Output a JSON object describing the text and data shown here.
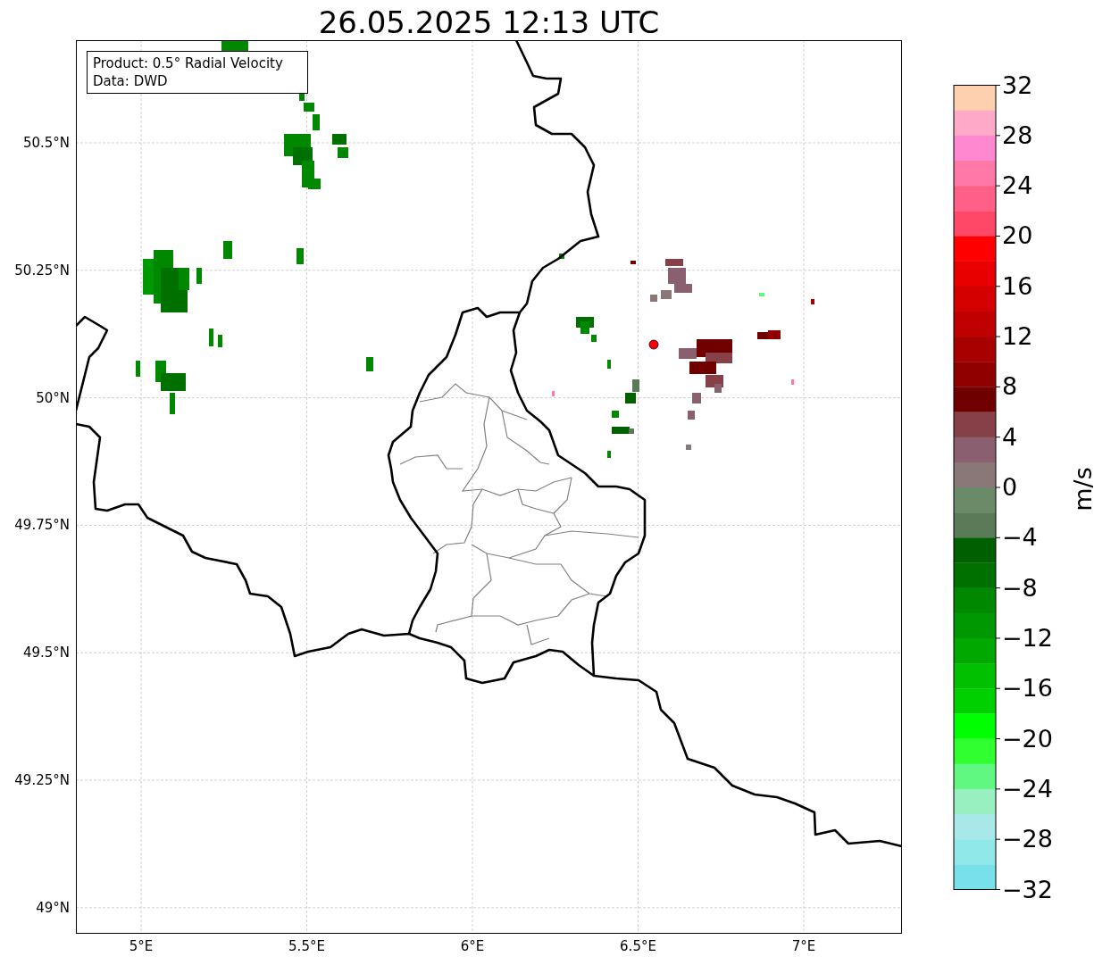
{
  "title": "26.05.2025 12:13 UTC",
  "legend": [
    "Product: 0.5° Radial Velocity",
    "Data: DWD"
  ],
  "x_ticks": [
    "5°E",
    "5.5°E",
    "6°E",
    "6.5°E",
    "7°E"
  ],
  "y_ticks": [
    "50.5°N",
    "50.25°N",
    "50°N",
    "49.75°N",
    "49.5°N",
    "49.25°N",
    "49°N"
  ],
  "colorbar": {
    "label": "m/s",
    "ticks": [
      "32",
      "28",
      "24",
      "20",
      "16",
      "12",
      "8",
      "4",
      "0",
      "−4",
      "−8",
      "−12",
      "−16",
      "−20",
      "−24",
      "−28",
      "−32"
    ],
    "segments": [
      {
        "color": "#ffd0b0"
      },
      {
        "color": "#ffaac8"
      },
      {
        "color": "#ff88d0"
      },
      {
        "color": "#ff78a8"
      },
      {
        "color": "#ff6088"
      },
      {
        "color": "#ff4868"
      },
      {
        "color": "#ff0000"
      },
      {
        "color": "#e80000"
      },
      {
        "color": "#d40000"
      },
      {
        "color": "#c00000"
      },
      {
        "color": "#a80000"
      },
      {
        "color": "#900000"
      },
      {
        "color": "#700000"
      },
      {
        "color": "#884048"
      },
      {
        "color": "#8a6070"
      },
      {
        "color": "#8a7878"
      },
      {
        "color": "#6a8a68"
      },
      {
        "color": "#5a7a58"
      },
      {
        "color": "#006000"
      },
      {
        "color": "#007000"
      },
      {
        "color": "#008800"
      },
      {
        "color": "#009800"
      },
      {
        "color": "#00a800"
      },
      {
        "color": "#00c000"
      },
      {
        "color": "#00d000"
      },
      {
        "color": "#00ff00"
      },
      {
        "color": "#30ff30"
      },
      {
        "color": "#60f880"
      },
      {
        "color": "#98f0c0"
      },
      {
        "color": "#a8e8e8"
      },
      {
        "color": "#90e8e8"
      },
      {
        "color": "#78e0e8"
      }
    ]
  }
}
